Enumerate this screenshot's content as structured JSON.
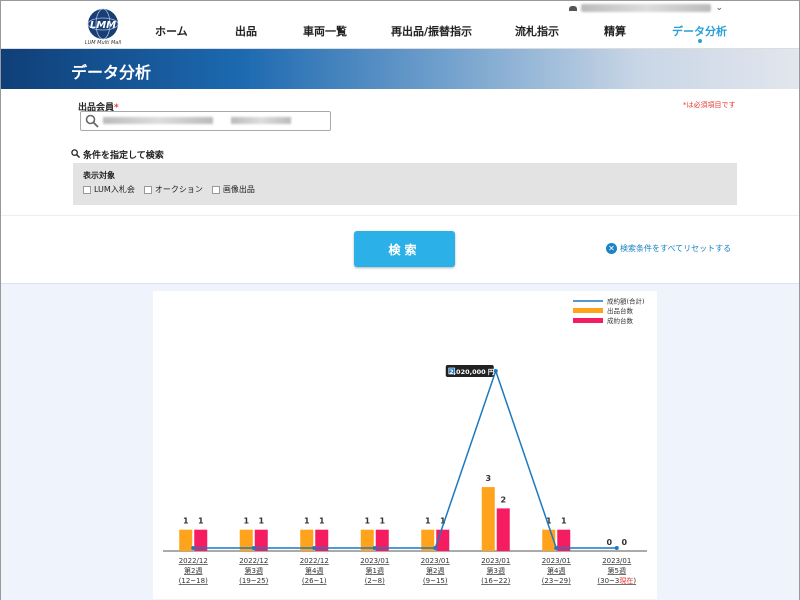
{
  "header": {
    "logo_text": "LMM",
    "logo_subtitle": "LUM Multi Mall",
    "nav": [
      {
        "label": "ホーム",
        "active": false
      },
      {
        "label": "出品",
        "active": false
      },
      {
        "label": "車両一覧",
        "active": false
      },
      {
        "label": "再出品/振替指示",
        "active": false
      },
      {
        "label": "流札指示",
        "active": false
      },
      {
        "label": "精算",
        "active": false
      },
      {
        "label": "データ分析",
        "active": true
      }
    ]
  },
  "banner": {
    "title": "データ分析"
  },
  "form": {
    "member_label": "出品会員",
    "required_mark": "*",
    "required_note": "*は必須項目です",
    "condition_toggle": "条件を指定して検索",
    "filter_title": "表示対象",
    "checkboxes": [
      "LUM入札会",
      "オークション",
      "画像出品"
    ],
    "search_button": "検索",
    "reset_link": "検索条件をすべてリセットする"
  },
  "colors": {
    "accent": "#2bb0e8",
    "bar_listed": "#ffa21c",
    "bar_sold": "#f51c62",
    "line_amount": "#1c79c0"
  },
  "chart_data": {
    "type": "bar",
    "categories": [
      [
        "2022/12",
        "第2週",
        "(12~18)"
      ],
      [
        "2022/12",
        "第3週",
        "(19~25)"
      ],
      [
        "2022/12",
        "第4週",
        "(26~1)"
      ],
      [
        "2023/01",
        "第1週",
        "(2~8)"
      ],
      [
        "2023/01",
        "第2週",
        "(9~15)"
      ],
      [
        "2023/01",
        "第3週",
        "(16~22)"
      ],
      [
        "2023/01",
        "第4週",
        "(23~29)"
      ],
      [
        "2023/01",
        "第5週",
        "(30~3現在)"
      ]
    ],
    "series": [
      {
        "name": "成約額(合計)",
        "type": "line",
        "values": [
          0,
          0,
          0,
          0,
          0,
          2020000,
          0,
          0
        ]
      },
      {
        "name": "出品台数",
        "type": "bar",
        "values": [
          1,
          1,
          1,
          1,
          1,
          3,
          1,
          0
        ]
      },
      {
        "name": "成約台数",
        "type": "bar",
        "values": [
          1,
          1,
          1,
          1,
          1,
          2,
          1,
          0
        ]
      }
    ],
    "tooltip": "2,020,000 円",
    "ylim": [
      0,
      3
    ],
    "legend": "top-right"
  }
}
